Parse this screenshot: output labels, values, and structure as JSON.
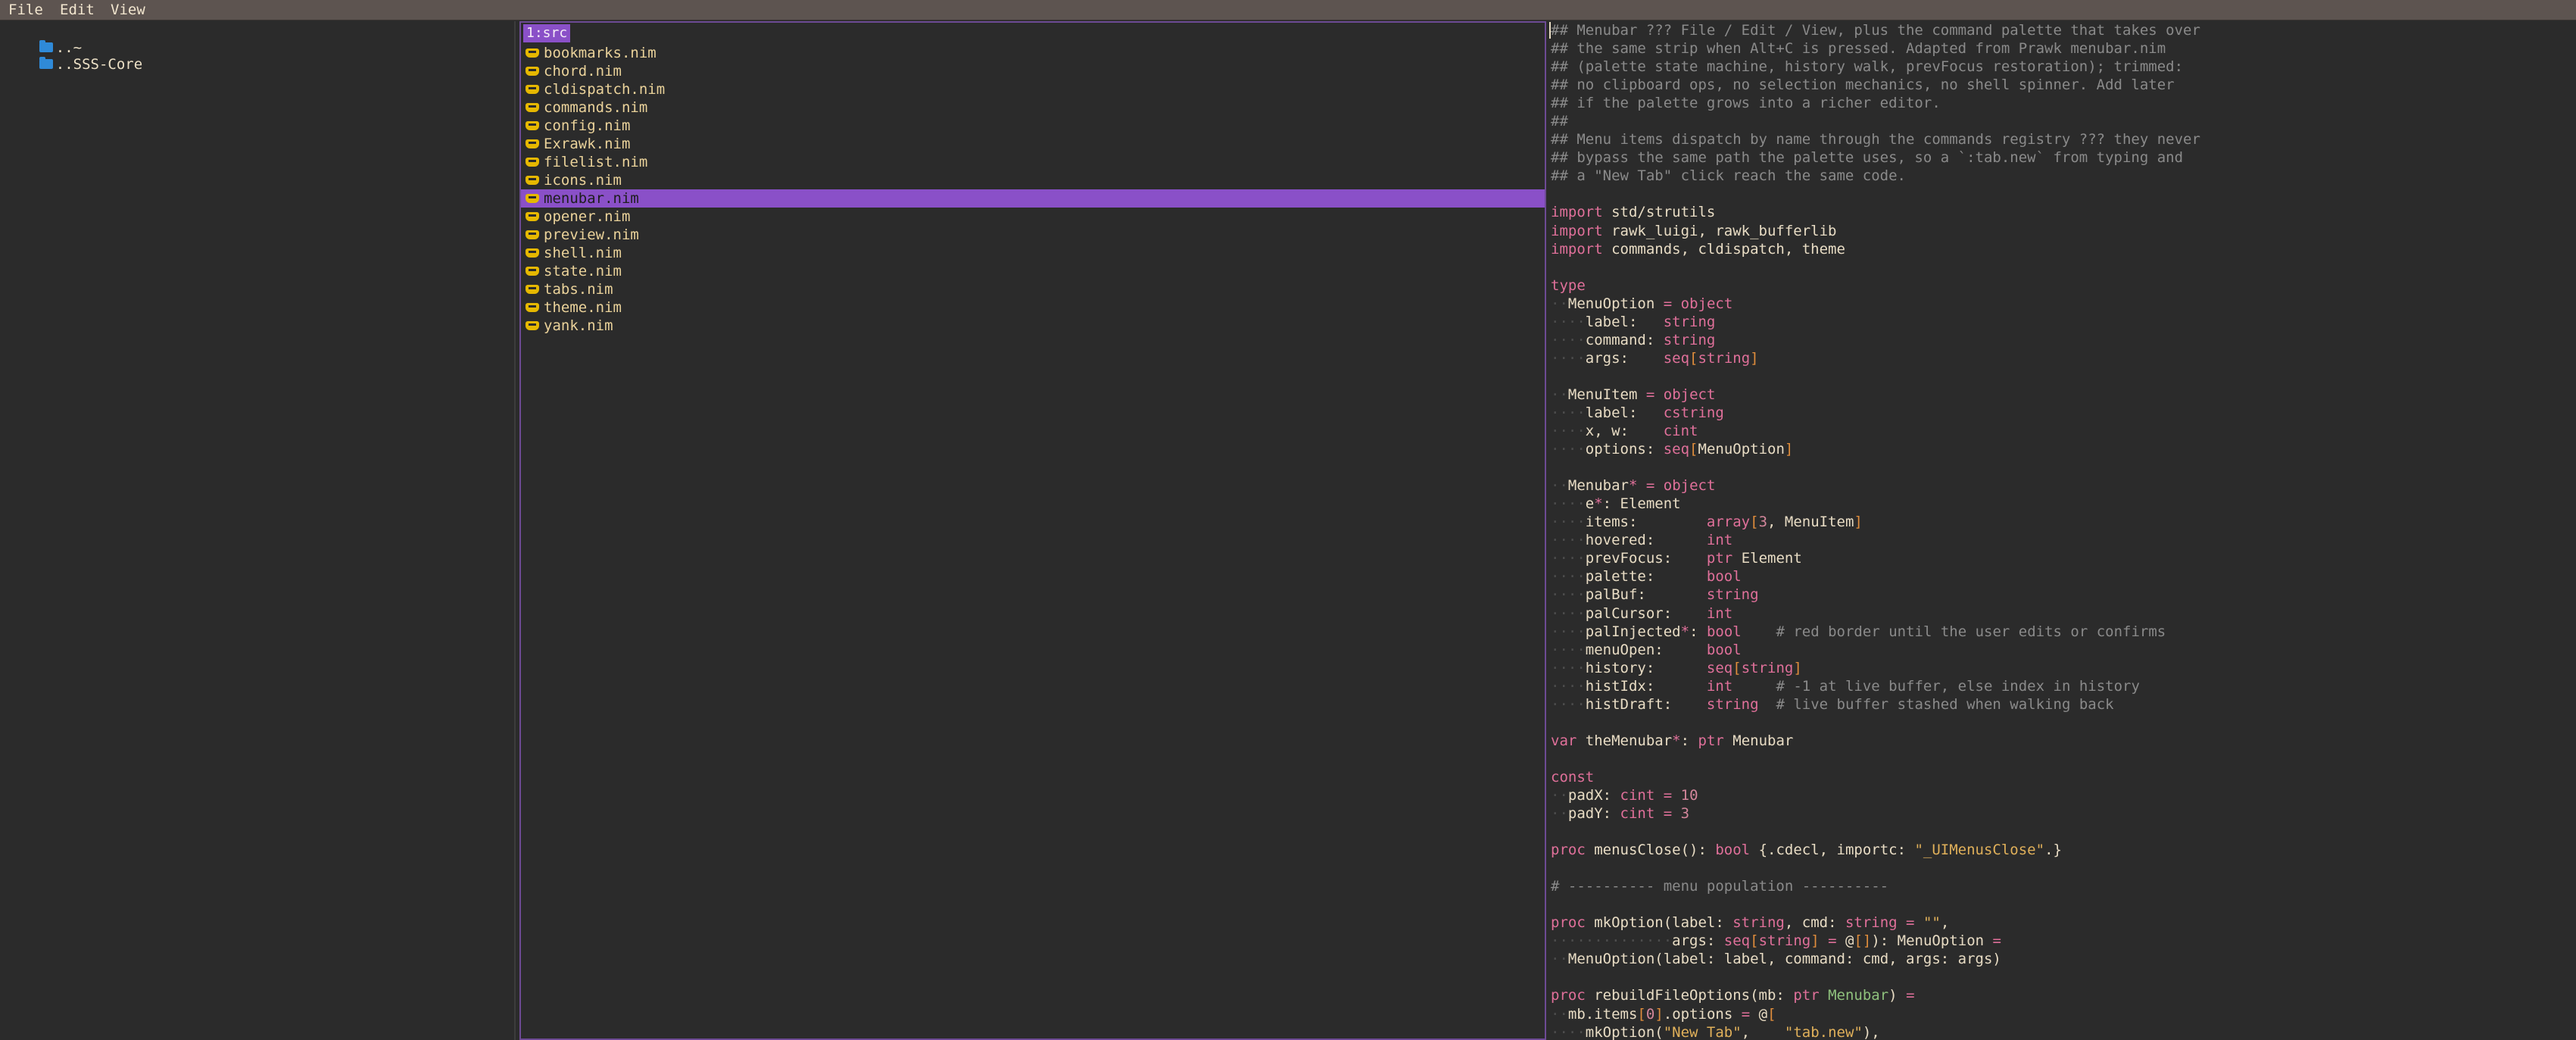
{
  "menubar": {
    "items": [
      "File",
      "Edit",
      "View"
    ]
  },
  "left_pane": {
    "entries": [
      "..~",
      "..SSS-Core"
    ]
  },
  "mid_pane": {
    "tab_label": "1:src",
    "files": [
      "bookmarks.nim",
      "chord.nim",
      "cldispatch.nim",
      "commands.nim",
      "config.nim",
      "Exrawk.nim",
      "filelist.nim",
      "icons.nim",
      "menubar.nim",
      "opener.nim",
      "preview.nim",
      "shell.nim",
      "state.nim",
      "tabs.nim",
      "theme.nim",
      "yank.nim"
    ],
    "selected_index": 8
  },
  "colors": {
    "accent": "#8a50c8",
    "icon_folder": "#2f8ad8",
    "icon_nim": "#e6b800"
  },
  "code": [
    [
      [
        "c",
        "## Menubar ??? File / Edit / View, plus the command palette that takes over"
      ]
    ],
    [
      [
        "c",
        "## the same strip when Alt+C is pressed. Adapted from Prawk menubar.nim"
      ]
    ],
    [
      [
        "c",
        "## (palette state machine, history walk, prevFocus restoration); trimmed:"
      ]
    ],
    [
      [
        "c",
        "## no clipboard ops, no selection mechanics, no shell spinner. Add later"
      ]
    ],
    [
      [
        "c",
        "## if the palette grows into a richer editor."
      ]
    ],
    [
      [
        "c",
        "##"
      ]
    ],
    [
      [
        "c",
        "## Menu items dispatch by name through the commands registry ??? they never"
      ]
    ],
    [
      [
        "c",
        "## bypass the same path the palette uses, so a `:tab.new` from typing and"
      ]
    ],
    [
      [
        "c",
        "## a \"New Tab\" click reach the same code."
      ]
    ],
    [],
    [
      [
        "k",
        "import"
      ],
      [
        "n",
        " std/strutils"
      ]
    ],
    [
      [
        "k",
        "import"
      ],
      [
        "n",
        " rawk_luigi, rawk_bufferlib"
      ]
    ],
    [
      [
        "k",
        "import"
      ],
      [
        "n",
        " commands, cldispatch, theme"
      ]
    ],
    [],
    [
      [
        "k",
        "type"
      ]
    ],
    [
      [
        "d",
        "··"
      ],
      [
        "n",
        "MenuOption "
      ],
      [
        "k",
        "="
      ],
      [
        "n",
        " "
      ],
      [
        "k",
        "object"
      ]
    ],
    [
      [
        "d",
        "····"
      ],
      [
        "n",
        "label:   "
      ],
      [
        "k",
        "string"
      ]
    ],
    [
      [
        "d",
        "····"
      ],
      [
        "n",
        "command: "
      ],
      [
        "k",
        "string"
      ]
    ],
    [
      [
        "d",
        "····"
      ],
      [
        "n",
        "args:    "
      ],
      [
        "k",
        "seq"
      ],
      [
        "b",
        "["
      ],
      [
        "k",
        "string"
      ],
      [
        "b",
        "]"
      ]
    ],
    [],
    [
      [
        "d",
        "··"
      ],
      [
        "n",
        "MenuItem "
      ],
      [
        "k",
        "="
      ],
      [
        "n",
        " "
      ],
      [
        "k",
        "object"
      ]
    ],
    [
      [
        "d",
        "····"
      ],
      [
        "n",
        "label:   "
      ],
      [
        "k",
        "cstring"
      ]
    ],
    [
      [
        "d",
        "····"
      ],
      [
        "n",
        "x, w:    "
      ],
      [
        "k",
        "cint"
      ]
    ],
    [
      [
        "d",
        "····"
      ],
      [
        "n",
        "options: "
      ],
      [
        "k",
        "seq"
      ],
      [
        "b",
        "["
      ],
      [
        "n",
        "MenuOption"
      ],
      [
        "b",
        "]"
      ]
    ],
    [],
    [
      [
        "d",
        "··"
      ],
      [
        "n",
        "Menubar"
      ],
      [
        "k",
        "*"
      ],
      [
        "n",
        " "
      ],
      [
        "k",
        "="
      ],
      [
        "n",
        " "
      ],
      [
        "k",
        "object"
      ]
    ],
    [
      [
        "d",
        "····"
      ],
      [
        "n",
        "e"
      ],
      [
        "k",
        "*"
      ],
      [
        "n",
        ": Element"
      ]
    ],
    [
      [
        "d",
        "····"
      ],
      [
        "n",
        "items:        "
      ],
      [
        "k",
        "array"
      ],
      [
        "b",
        "["
      ],
      [
        "u",
        "3"
      ],
      [
        "n",
        ", MenuItem"
      ],
      [
        "b",
        "]"
      ]
    ],
    [
      [
        "d",
        "····"
      ],
      [
        "n",
        "hovered:      "
      ],
      [
        "k",
        "int"
      ]
    ],
    [
      [
        "d",
        "····"
      ],
      [
        "n",
        "prevFocus:    "
      ],
      [
        "k",
        "ptr"
      ],
      [
        "n",
        " Element"
      ]
    ],
    [
      [
        "d",
        "····"
      ],
      [
        "n",
        "palette:      "
      ],
      [
        "k",
        "bool"
      ]
    ],
    [
      [
        "d",
        "····"
      ],
      [
        "n",
        "palBuf:       "
      ],
      [
        "k",
        "string"
      ]
    ],
    [
      [
        "d",
        "····"
      ],
      [
        "n",
        "palCursor:    "
      ],
      [
        "k",
        "int"
      ]
    ],
    [
      [
        "d",
        "····"
      ],
      [
        "n",
        "palInjected"
      ],
      [
        "k",
        "*"
      ],
      [
        "n",
        ": "
      ],
      [
        "k",
        "bool"
      ],
      [
        "n",
        "    "
      ],
      [
        "c",
        "# red border until the user edits or confirms"
      ]
    ],
    [
      [
        "d",
        "····"
      ],
      [
        "n",
        "menuOpen:     "
      ],
      [
        "k",
        "bool"
      ]
    ],
    [
      [
        "d",
        "····"
      ],
      [
        "n",
        "history:      "
      ],
      [
        "k",
        "seq"
      ],
      [
        "b",
        "["
      ],
      [
        "k",
        "string"
      ],
      [
        "b",
        "]"
      ]
    ],
    [
      [
        "d",
        "····"
      ],
      [
        "n",
        "histIdx:      "
      ],
      [
        "k",
        "int"
      ],
      [
        "n",
        "     "
      ],
      [
        "c",
        "# -1 at live buffer, else index in history"
      ]
    ],
    [
      [
        "d",
        "····"
      ],
      [
        "n",
        "histDraft:    "
      ],
      [
        "k",
        "string"
      ],
      [
        "n",
        "  "
      ],
      [
        "c",
        "# live buffer stashed when walking back"
      ]
    ],
    [],
    [
      [
        "k",
        "var"
      ],
      [
        "n",
        " theMenubar"
      ],
      [
        "k",
        "*"
      ],
      [
        "n",
        ": "
      ],
      [
        "k",
        "ptr"
      ],
      [
        "n",
        " Menubar"
      ]
    ],
    [],
    [
      [
        "k",
        "const"
      ]
    ],
    [
      [
        "d",
        "··"
      ],
      [
        "n",
        "padX: "
      ],
      [
        "k",
        "cint"
      ],
      [
        "n",
        " "
      ],
      [
        "k",
        "="
      ],
      [
        "n",
        " "
      ],
      [
        "u",
        "10"
      ]
    ],
    [
      [
        "d",
        "··"
      ],
      [
        "n",
        "padY: "
      ],
      [
        "k",
        "cint"
      ],
      [
        "n",
        " "
      ],
      [
        "k",
        "="
      ],
      [
        "n",
        " "
      ],
      [
        "u",
        "3"
      ]
    ],
    [],
    [
      [
        "k",
        "proc"
      ],
      [
        "n",
        " menusClose(): "
      ],
      [
        "k",
        "bool"
      ],
      [
        "n",
        " {.cdecl, importc: "
      ],
      [
        "s",
        "\"_UIMenusClose\""
      ],
      [
        "n",
        ".}"
      ]
    ],
    [],
    [
      [
        "c",
        "# ---------- menu population ----------"
      ]
    ],
    [],
    [
      [
        "k",
        "proc"
      ],
      [
        "n",
        " mkOption(label: "
      ],
      [
        "k",
        "string"
      ],
      [
        "n",
        ", cmd: "
      ],
      [
        "k",
        "string"
      ],
      [
        "n",
        " "
      ],
      [
        "k",
        "="
      ],
      [
        "n",
        " "
      ],
      [
        "s",
        "\"\""
      ],
      [
        "n",
        ","
      ]
    ],
    [
      [
        "d",
        "··············"
      ],
      [
        "n",
        "args: "
      ],
      [
        "k",
        "seq"
      ],
      [
        "b",
        "["
      ],
      [
        "k",
        "string"
      ],
      [
        "b",
        "]"
      ],
      [
        "n",
        " "
      ],
      [
        "k",
        "="
      ],
      [
        "n",
        " @"
      ],
      [
        "b",
        "[]"
      ],
      [
        "n",
        "): MenuOption "
      ],
      [
        "k",
        "="
      ]
    ],
    [
      [
        "d",
        "··"
      ],
      [
        "n",
        "MenuOption(label: label, command: cmd, args: args)"
      ]
    ],
    [],
    [
      [
        "k",
        "proc"
      ],
      [
        "n",
        " rebuildFileOptions(mb: "
      ],
      [
        "k",
        "ptr"
      ],
      [
        "n",
        " "
      ],
      [
        "t",
        "Menubar"
      ],
      [
        "n",
        ") "
      ],
      [
        "k",
        "="
      ]
    ],
    [
      [
        "d",
        "··"
      ],
      [
        "n",
        "mb.items"
      ],
      [
        "b",
        "["
      ],
      [
        "u",
        "0"
      ],
      [
        "b",
        "]"
      ],
      [
        "n",
        ".options "
      ],
      [
        "k",
        "="
      ],
      [
        "n",
        " @"
      ],
      [
        "b",
        "["
      ]
    ],
    [
      [
        "d",
        "····"
      ],
      [
        "n",
        "mkOption("
      ],
      [
        "s",
        "\"New Tab\""
      ],
      [
        "n",
        ",    "
      ],
      [
        "s",
        "\"tab.new\""
      ],
      [
        "n",
        "),"
      ]
    ]
  ]
}
